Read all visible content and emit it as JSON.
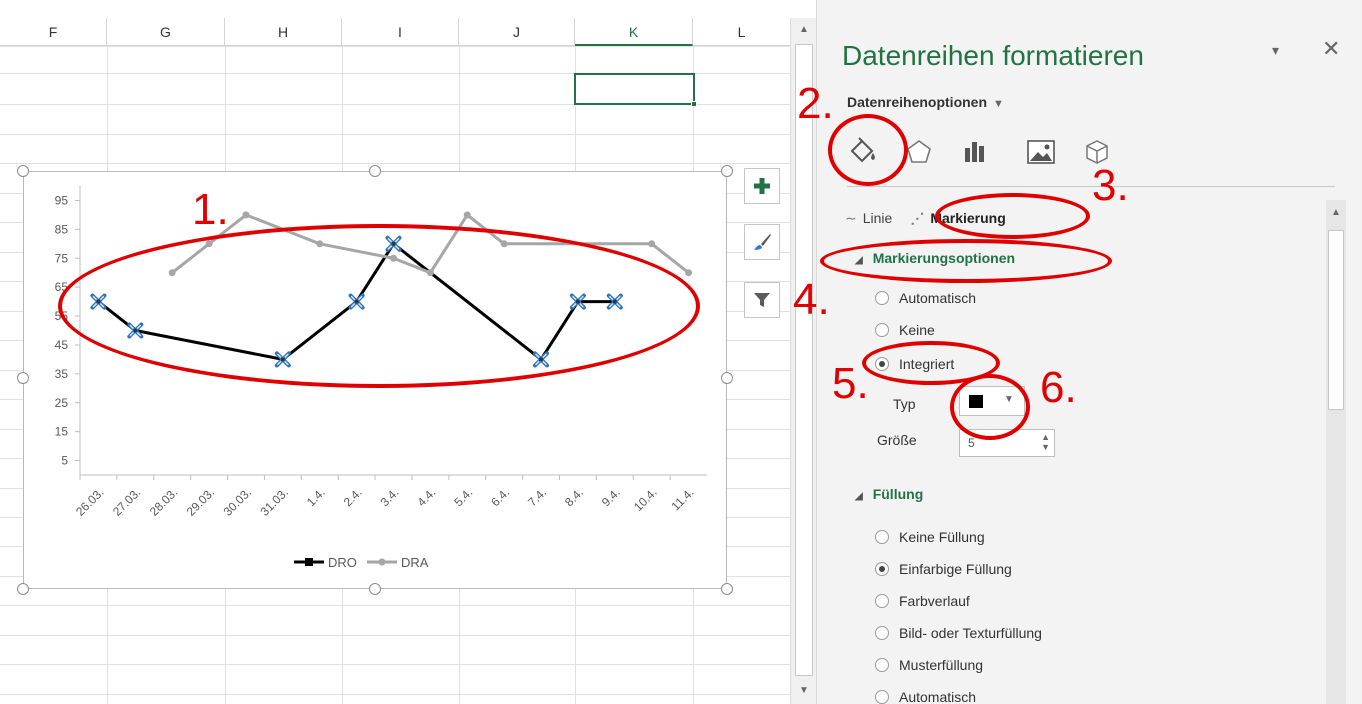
{
  "sheet": {
    "columns": [
      "F",
      "G",
      "H",
      "I",
      "J",
      "K",
      "L"
    ],
    "active_column": "K"
  },
  "chart_data": {
    "type": "line",
    "categories": [
      "26.03.",
      "27.03.",
      "28.03.",
      "29.03.",
      "30.03.",
      "31.03.",
      "1.4.",
      "2.4.",
      "3.4.",
      "4.4.",
      "5.4.",
      "6.4.",
      "7.4.",
      "8.4.",
      "9.4.",
      "10.4.",
      "11.4."
    ],
    "yticks": [
      5,
      15,
      25,
      35,
      45,
      55,
      65,
      75,
      85,
      95
    ],
    "ylim": [
      0,
      100
    ],
    "series": [
      {
        "name": "DRO",
        "color": "#000000",
        "marker": "x",
        "values": [
          60,
          50,
          null,
          null,
          null,
          40,
          null,
          60,
          80,
          null,
          null,
          null,
          40,
          60,
          60,
          null,
          null
        ]
      },
      {
        "name": "DRA",
        "color": "#a6a6a6",
        "marker": "circle",
        "values": [
          null,
          null,
          70,
          80,
          90,
          null,
          80,
          null,
          75,
          70,
          90,
          80,
          null,
          null,
          null,
          80,
          70
        ]
      }
    ],
    "legend_position": "bottom"
  },
  "chart_buttons": [
    "plus-icon",
    "brush-icon",
    "filter-icon"
  ],
  "pane": {
    "title": "Datenreihen formatieren",
    "dropdown_glyph": "▾",
    "close_glyph": "✕",
    "series_options_label": "Datenreihenoptionen",
    "tabs": [
      "fill-line-icon",
      "effects-icon",
      "series-options-icon",
      "picture-icon",
      "3d-format-icon"
    ],
    "subtab_line": "Linie",
    "subtab_marker": "Markierung",
    "marker_options_header": "Markierungsoptionen",
    "marker_options": [
      {
        "label": "Automatisch",
        "checked": false
      },
      {
        "label": "Keine",
        "checked": false
      },
      {
        "label": "Integriert",
        "checked": true
      }
    ],
    "typ_label": "Typ",
    "size_label": "Größe",
    "size_value": "5",
    "fill_header": "Füllung",
    "fill_options": [
      {
        "label": "Keine Füllung",
        "checked": false
      },
      {
        "label": "Einfarbige Füllung",
        "checked": true
      },
      {
        "label": "Farbverlauf",
        "checked": false
      },
      {
        "label": "Bild- oder Texturfüllung",
        "checked": false
      },
      {
        "label": "Musterfüllung",
        "checked": false
      },
      {
        "label": "Automatisch",
        "checked": false
      }
    ]
  },
  "annotations": [
    "1.",
    "2.",
    "3.",
    "4.",
    "5.",
    "6."
  ],
  "colors": {
    "accent": "#217346",
    "annotation": "#e00000"
  }
}
